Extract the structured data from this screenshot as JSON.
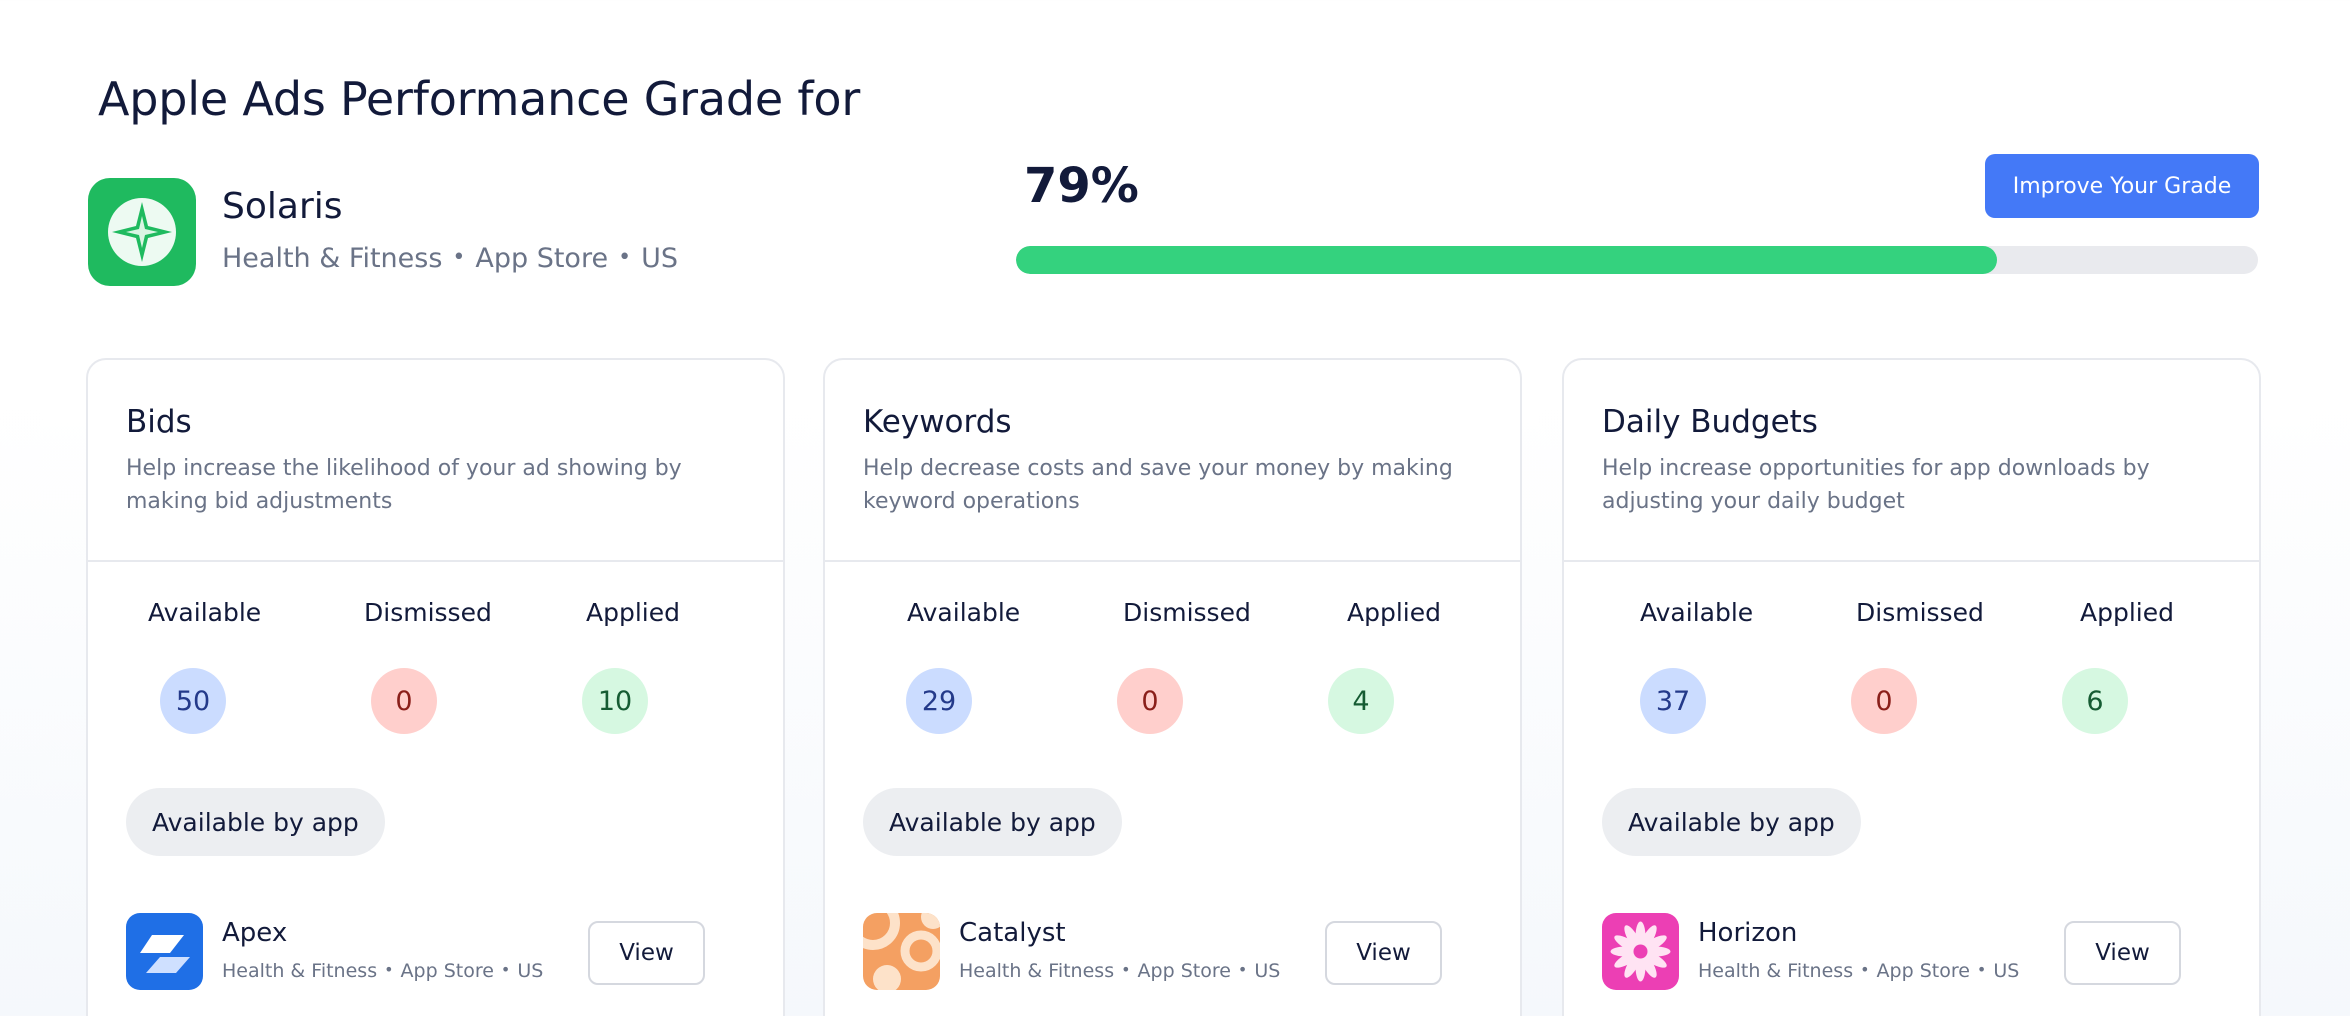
{
  "page": {
    "title": "Apple Ads Performance Grade for"
  },
  "app": {
    "name": "Solaris",
    "category": "Health & Fitness",
    "store": "App Store",
    "country": "US"
  },
  "grade": {
    "percent_label": "79%",
    "percent": 79,
    "improve_label": "Improve Your Grade"
  },
  "colors": {
    "accent": "#4479f7",
    "progress": "#34d27e",
    "available": "#cbdcff",
    "dismissed": "#ffcfcc",
    "applied": "#d6f8e1"
  },
  "cards": [
    {
      "title": "Bids",
      "description": "Help increase the likelihood of your ad showing by making bid adjustments",
      "stats": {
        "available_label": "Available",
        "dismissed_label": "Dismissed",
        "applied_label": "Applied",
        "available": "50",
        "dismissed": "0",
        "applied": "10"
      },
      "pill_label": "Available by app",
      "app": {
        "name": "Apex",
        "category": "Health & Fitness",
        "store": "App Store",
        "country": "US",
        "icon": "apex-app-icon"
      },
      "view_label": "View"
    },
    {
      "title": "Keywords",
      "description": "Help decrease costs and save your money by making keyword operations",
      "stats": {
        "available_label": "Available",
        "dismissed_label": "Dismissed",
        "applied_label": "Applied",
        "available": "29",
        "dismissed": "0",
        "applied": "4"
      },
      "pill_label": "Available by app",
      "app": {
        "name": "Catalyst",
        "category": "Health & Fitness",
        "store": "App Store",
        "country": "US",
        "icon": "catalyst-app-icon"
      },
      "view_label": "View"
    },
    {
      "title": "Daily Budgets",
      "description": "Help increase opportunities for app downloads by adjusting your daily budget",
      "stats": {
        "available_label": "Available",
        "dismissed_label": "Dismissed",
        "applied_label": "Applied",
        "available": "37",
        "dismissed": "0",
        "applied": "6"
      },
      "pill_label": "Available by app",
      "app": {
        "name": "Horizon",
        "category": "Health & Fitness",
        "store": "App Store",
        "country": "US",
        "icon": "horizon-app-icon"
      },
      "view_label": "View"
    }
  ]
}
